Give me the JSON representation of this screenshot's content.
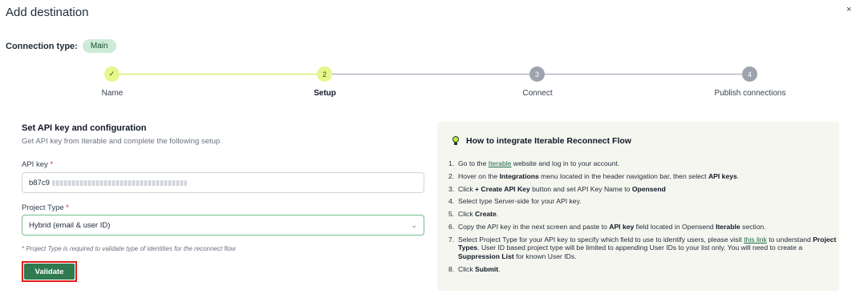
{
  "dialog": {
    "title": "Add destination",
    "close_icon": "×"
  },
  "connection": {
    "label": "Connection type:",
    "badge": "Main"
  },
  "stepper": {
    "steps": [
      {
        "marker": "✓",
        "label": "Name",
        "state": "completed"
      },
      {
        "marker": "2",
        "label": "Setup",
        "state": "current"
      },
      {
        "marker": "3",
        "label": "Connect",
        "state": "upcoming"
      },
      {
        "marker": "4",
        "label": "Publish connections",
        "state": "upcoming"
      }
    ]
  },
  "form": {
    "title": "Set API key and configuration",
    "subtitle": "Get API key from Iterable and complete the following setup",
    "api_key": {
      "label": "API key",
      "required_mark": "*",
      "value_prefix": "b87c9"
    },
    "project_type": {
      "label": "Project Type",
      "required_mark": "*",
      "selected": "Hybrid (email & user ID)",
      "chevron": "⌄"
    },
    "note": "* Project Type is required to validate type of identities for the reconnect flow",
    "validate_label": "Validate"
  },
  "help": {
    "title": "How to integrate Iterable Reconnect Flow",
    "steps": {
      "s1": {
        "n": "1.",
        "a": "Go to the ",
        "link": "Iterable",
        "b": " website and log in to your account."
      },
      "s2": {
        "n": "2.",
        "a": "Hover on the ",
        "b1": "Integrations",
        "c": " menu located in the header navigation bar, then select ",
        "b2": "API keys",
        "d": "."
      },
      "s3": {
        "n": "3.",
        "a": "Click ",
        "b1": "+ Create API Key",
        "c": " button and set API Key Name to ",
        "b2": "Opensend"
      },
      "s4": {
        "n": "4.",
        "a": "Select type Server-side for your API key."
      },
      "s5": {
        "n": "5.",
        "a": "Click ",
        "b1": "Create",
        "c": "."
      },
      "s6": {
        "n": "6.",
        "a": "Copy the API key in the next screen and paste to ",
        "b1": "API key",
        "c": " field located in Opensend ",
        "b2": "Iterable",
        "d": " section."
      },
      "s7": {
        "n": "7.",
        "a": "Select Project Type for your API key to specify which field to use to identify users, please visit ",
        "link": "this link",
        "b": " to understand ",
        "b1": "Project Types",
        "c": ". User ID based project type will be limited to appending User IDs to your list only. You will need to create a ",
        "b2": "Suppression List",
        "d": " for known User IDs."
      },
      "s8": {
        "n": "8.",
        "a": "Click ",
        "b1": "Submit",
        "c": "."
      }
    }
  },
  "colors": {
    "accent_green": "#2f7a4f",
    "step_active": "#e4f88a",
    "step_line_done": "#c3ea3f",
    "step_inactive": "#9ca3af",
    "badge_bg": "#cdebd6",
    "highlight_border": "#e11d1d"
  }
}
